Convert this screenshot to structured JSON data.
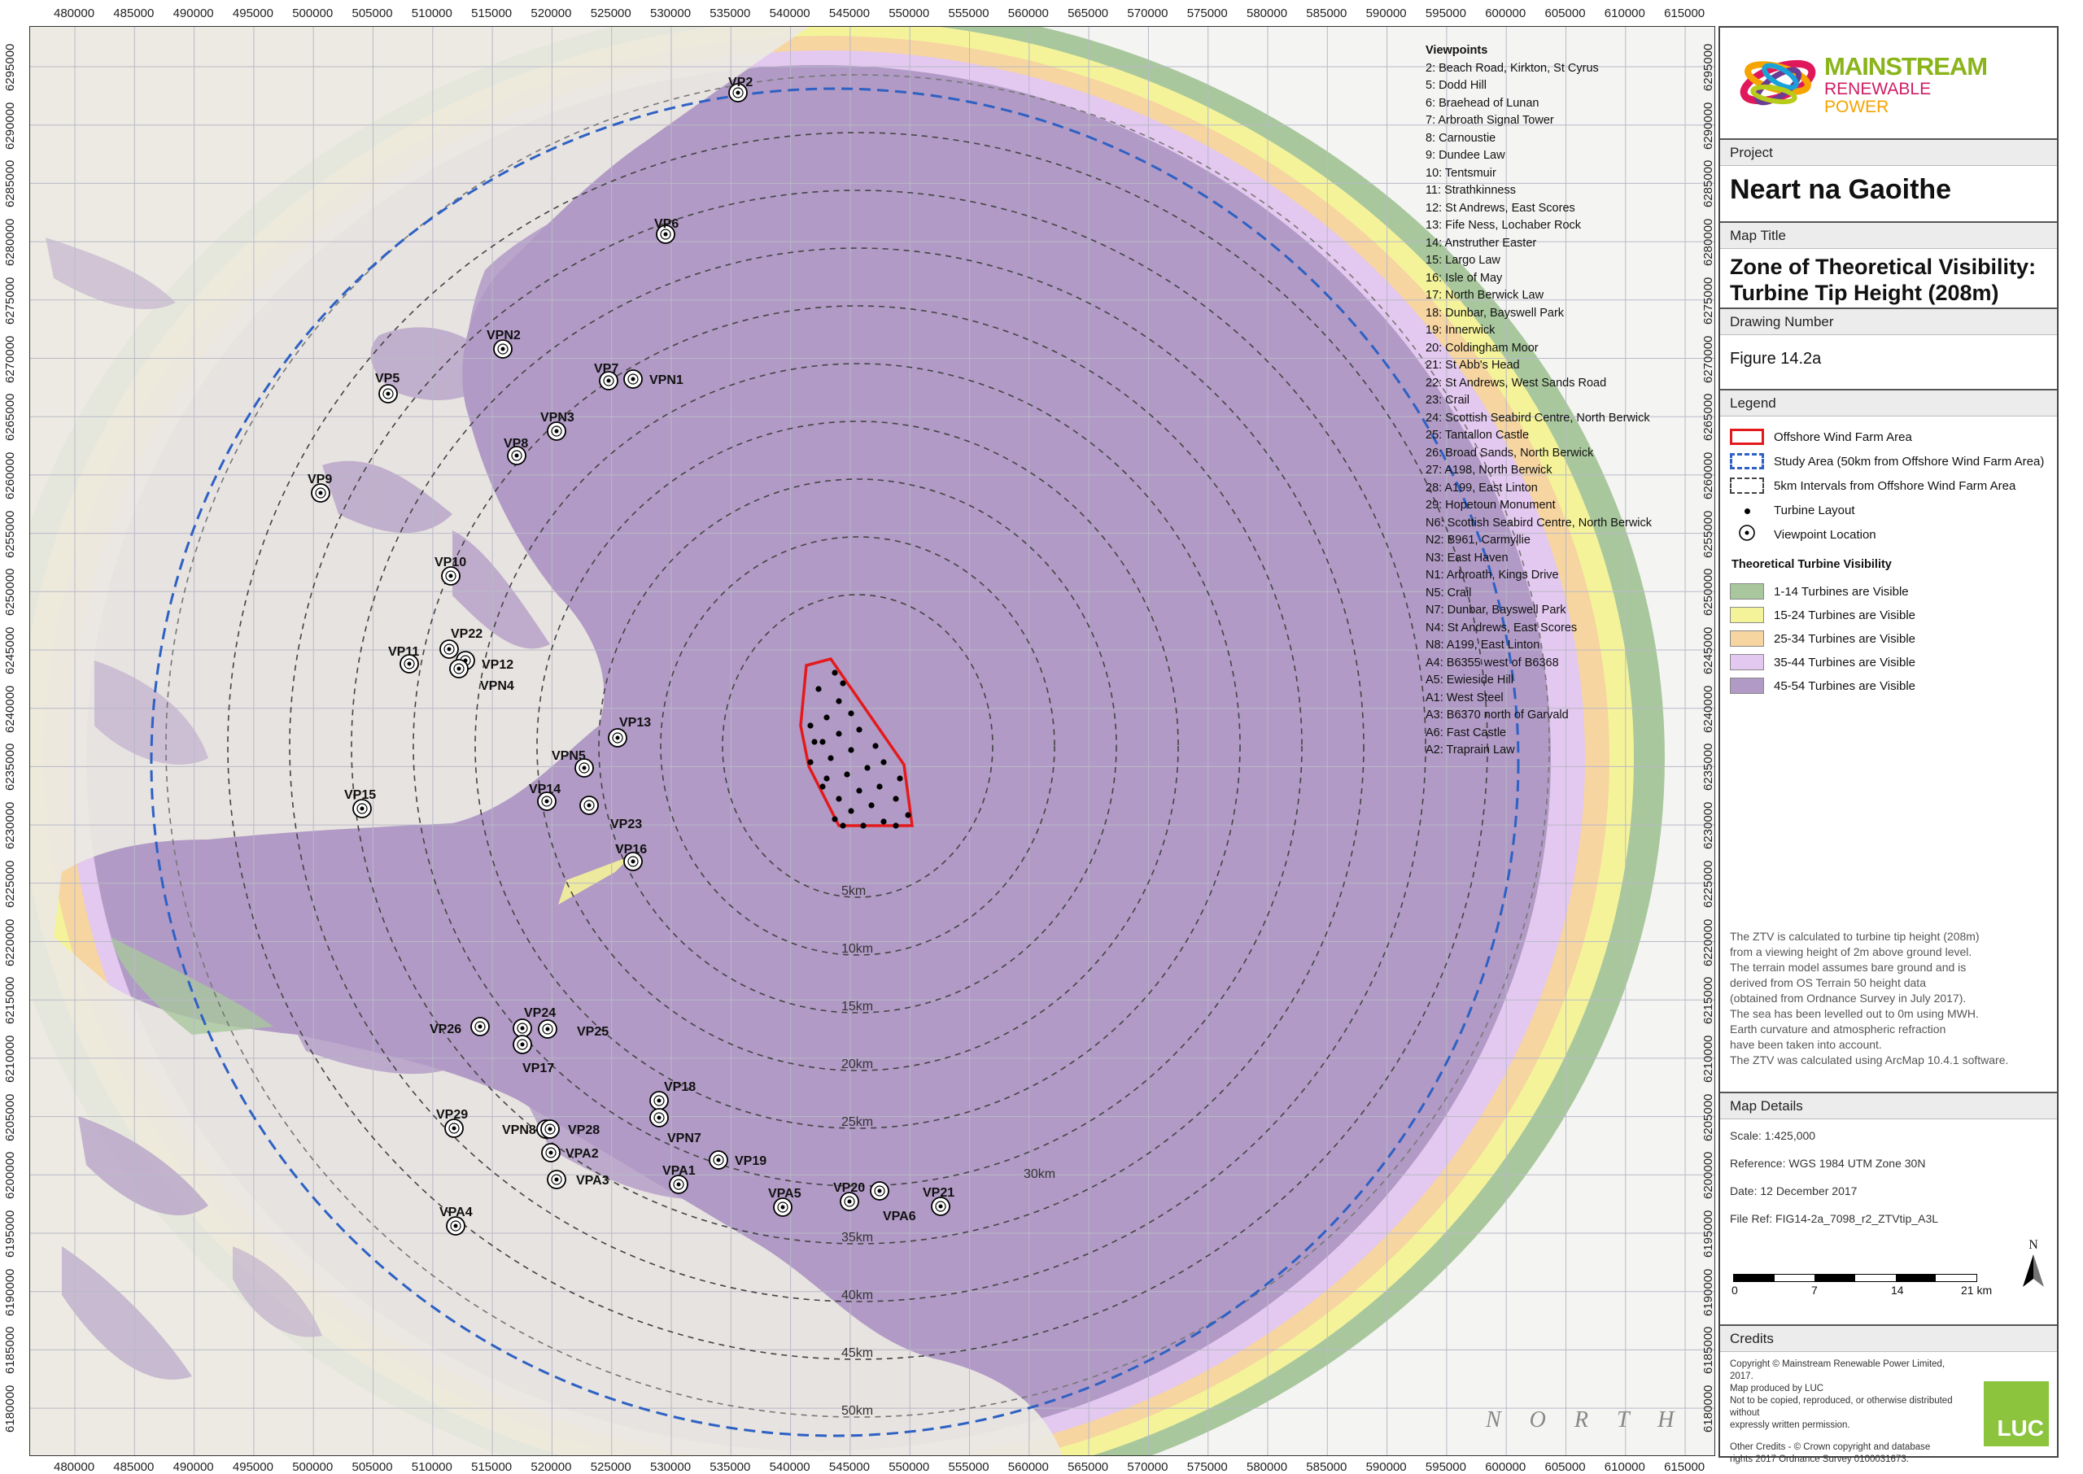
{
  "axis": {
    "x_ticks": [
      "480000",
      "485000",
      "490000",
      "495000",
      "500000",
      "505000",
      "510000",
      "515000",
      "520000",
      "525000",
      "530000",
      "535000",
      "540000",
      "545000",
      "550000",
      "555000",
      "560000",
      "565000",
      "570000",
      "575000",
      "580000",
      "585000",
      "590000",
      "595000",
      "600000",
      "605000",
      "610000",
      "615000"
    ],
    "y_ticks": [
      "6295000",
      "6290000",
      "6285000",
      "6280000",
      "6275000",
      "6270000",
      "6265000",
      "6260000",
      "6255000",
      "6250000",
      "6245000",
      "6240000",
      "6235000",
      "6230000",
      "6225000",
      "6220000",
      "6215000",
      "6210000",
      "6205000",
      "6200000",
      "6195000",
      "6190000",
      "6185000",
      "6180000"
    ]
  },
  "map": {
    "rings": [
      "5km",
      "10km",
      "15km",
      "20km",
      "25km",
      "30km",
      "35km",
      "40km",
      "45km",
      "50km"
    ],
    "sea_text": "N O R T H",
    "viewpoints": [
      "VP2",
      "VP6",
      "VPN2",
      "VP7",
      "VPN1",
      "VP5",
      "VPN3",
      "VP8",
      "VP9",
      "VP10",
      "VP22",
      "VP11",
      "VP12",
      "VPN4",
      "VP13",
      "VPN5",
      "VP14",
      "VP23",
      "VP15",
      "VP16",
      "VP24",
      "VP26",
      "VP25",
      "VP17",
      "VP18",
      "VPN7",
      "VP29",
      "VPN8",
      "VP28",
      "VPA2",
      "VP19",
      "VPA1",
      "VPA3",
      "VPA5",
      "VP20",
      "VPA6",
      "VP21",
      "VPA4"
    ]
  },
  "viewpoints_list": {
    "title": "Viewpoints",
    "items": [
      "2: Beach Road, Kirkton, St Cyrus",
      "5: Dodd Hill",
      "6: Braehead of Lunan",
      "7: Arbroath Signal Tower",
      "8: Carnoustie",
      "9: Dundee Law",
      "10: Tentsmuir",
      "11: Strathkinness",
      "12: St Andrews, East Scores",
      "13: Fife Ness, Lochaber Rock",
      "14: Anstruther Easter",
      "15: Largo Law",
      "16: Isle of May",
      "17: North Berwick Law",
      "18: Dunbar, Bayswell Park",
      "19: Innerwick",
      "20: Coldingham Moor",
      "21: St Abb's Head",
      "22: St Andrews, West Sands Road",
      "23: Crail",
      "24: Scottish Seabird Centre, North Berwick",
      "25: Tantallon Castle",
      "26: Broad Sands, North Berwick",
      "27: A198, North Berwick",
      "28: A199, East Linton",
      "29: Hopetoun Monument",
      "N6: Scottish Seabird Centre, North Berwick",
      "N2: B961, Carmyllie",
      "N3: East Haven",
      "N1: Arbroath, Kings Drive",
      "N5: Crail",
      "N7: Dunbar, Bayswell Park",
      "N4: St Andrews, East Scores",
      "N8: A199, East Linton",
      "A4: B6355 west of B6368",
      "A5: Ewieside Hill",
      "A1: West Steel",
      "A3: B6370 north of Garvald",
      "A6: Fast Castle",
      "A2: Traprain Law"
    ]
  },
  "panel": {
    "logo": {
      "line1": "MAINSTREAM",
      "line2": "RENEWABLE",
      "line3": "POWER"
    },
    "project_label": "Project",
    "project": "Neart na Gaoithe",
    "map_title_label": "Map Title",
    "map_title_1": "Zone of Theoretical Visibility:",
    "map_title_2": "Turbine Tip Height (208m)",
    "drawing_label": "Drawing Number",
    "drawing": "Figure 14.2a",
    "legend_label": "Legend",
    "legend": [
      {
        "label": "Offshore Wind Farm Area"
      },
      {
        "label": "Study Area (50km from Offshore Wind Farm Area)"
      },
      {
        "label": "5km Intervals from Offshore Wind Farm Area"
      },
      {
        "label": "Turbine Layout"
      },
      {
        "label": "Viewpoint Location"
      }
    ],
    "visibility_title": "Theoretical Turbine Visibility",
    "visibility": [
      {
        "label": "1-14 Turbines are Visible",
        "color": "#a9c79d"
      },
      {
        "label": "15-24 Turbines are Visible",
        "color": "#f4f39a"
      },
      {
        "label": "25-34 Turbines are Visible",
        "color": "#f6d5a0"
      },
      {
        "label": "35-44 Turbines are Visible",
        "color": "#e3c8ef"
      },
      {
        "label": "45-54 Turbines are Visible",
        "color": "#b19ac5"
      }
    ],
    "ztv_note": [
      "The ZTV is calculated to turbine tip height (208m)",
      "from a viewing height of 2m above ground level.",
      "The terrain model assumes bare ground and is",
      "derived from OS Terrain 50 height data",
      "(obtained from Ordnance Survey in July 2017).",
      "The sea has been levelled out to 0m using MWH.",
      "Earth curvature and atmospheric refraction",
      "have been taken into account.",
      "The ZTV was calculated using ArcMap 10.4.1 software."
    ],
    "details_label": "Map Details",
    "scale": "Scale: 1:425,000",
    "reference": "Reference: WGS 1984 UTM Zone 30N",
    "date": "Date: 12 December 2017",
    "file_ref": "File Ref: FIG14-2a_7098_r2_ZTVtip_A3L",
    "scalebar": [
      "0",
      "7",
      "14",
      "21 km"
    ],
    "north": "N",
    "credits_label": "Credits",
    "credits": [
      "Copyright © Mainstream Renewable Power Limited, 2017.",
      "Map produced by LUC",
      "Not to be copied, reproduced, or otherwise distributed without",
      "expressly written permission."
    ],
    "other_credits": [
      "Other Credits - © Crown copyright and database",
      "rights 2017 Ordnance Survey 0100031673."
    ],
    "luc": "LUC"
  }
}
